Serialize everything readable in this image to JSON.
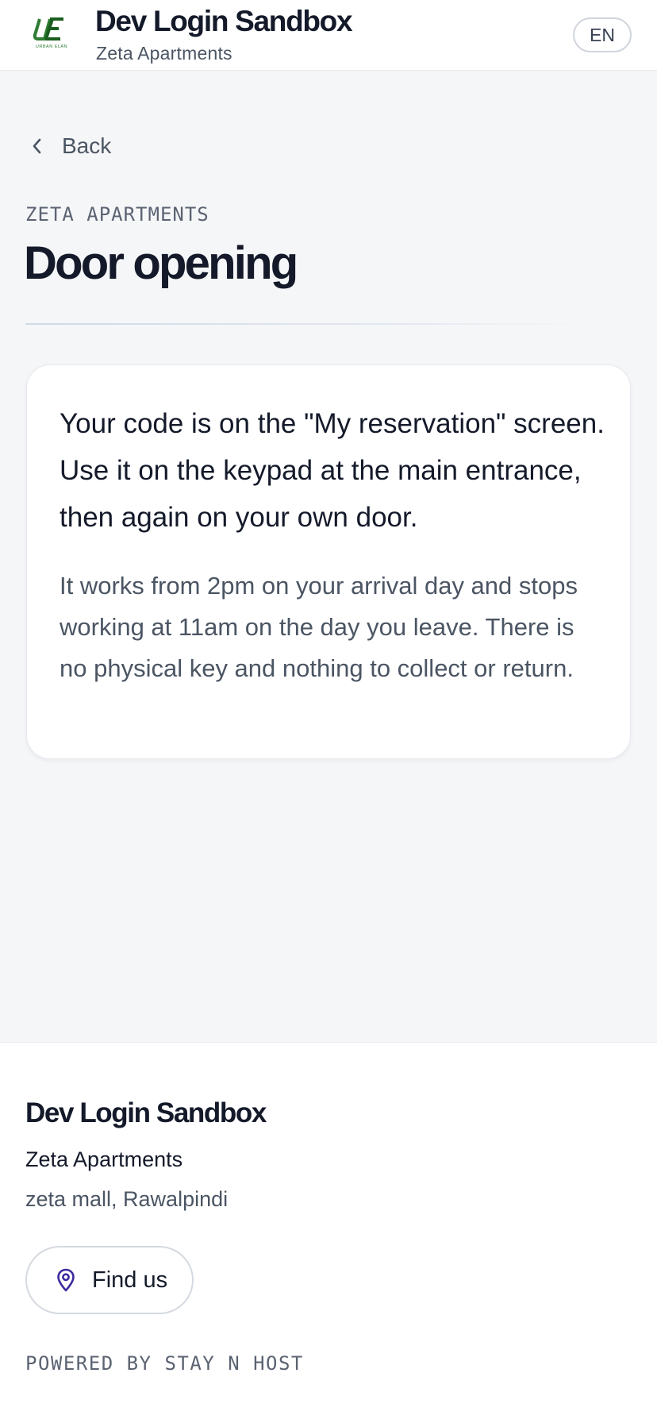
{
  "header": {
    "logo_icon": "urban-elan-logo",
    "logo_text": "URBAN ELAN",
    "title": "Dev Login Sandbox",
    "subtitle": "Zeta Apartments",
    "language": "EN"
  },
  "nav": {
    "back_label": "Back",
    "back_icon": "chevron-left-icon"
  },
  "page": {
    "eyebrow": "ZETA APARTMENTS",
    "title": "Door opening"
  },
  "card": {
    "lead": "Your code is on the \"My reservation\" screen. Use it on the keypad at the main entrance, then again on your own door.",
    "body": "It works from 2pm on your arrival day and stops working at 11am on the day you leave. There is no physical key and nothing to collect or return."
  },
  "footer": {
    "title": "Dev Login Sandbox",
    "property": "Zeta Apartments",
    "address": "zeta mall, Rawalpindi",
    "find_us_label": "Find us",
    "find_us_icon": "map-pin-icon",
    "powered_by": "POWERED BY STAY N HOST"
  },
  "colors": {
    "background": "#f5f6f8",
    "surface": "#ffffff",
    "text_primary": "#141a2a",
    "text_secondary": "#4b5563",
    "accent_pin": "#3b2a9e",
    "logo_green": "#2e7d32"
  }
}
